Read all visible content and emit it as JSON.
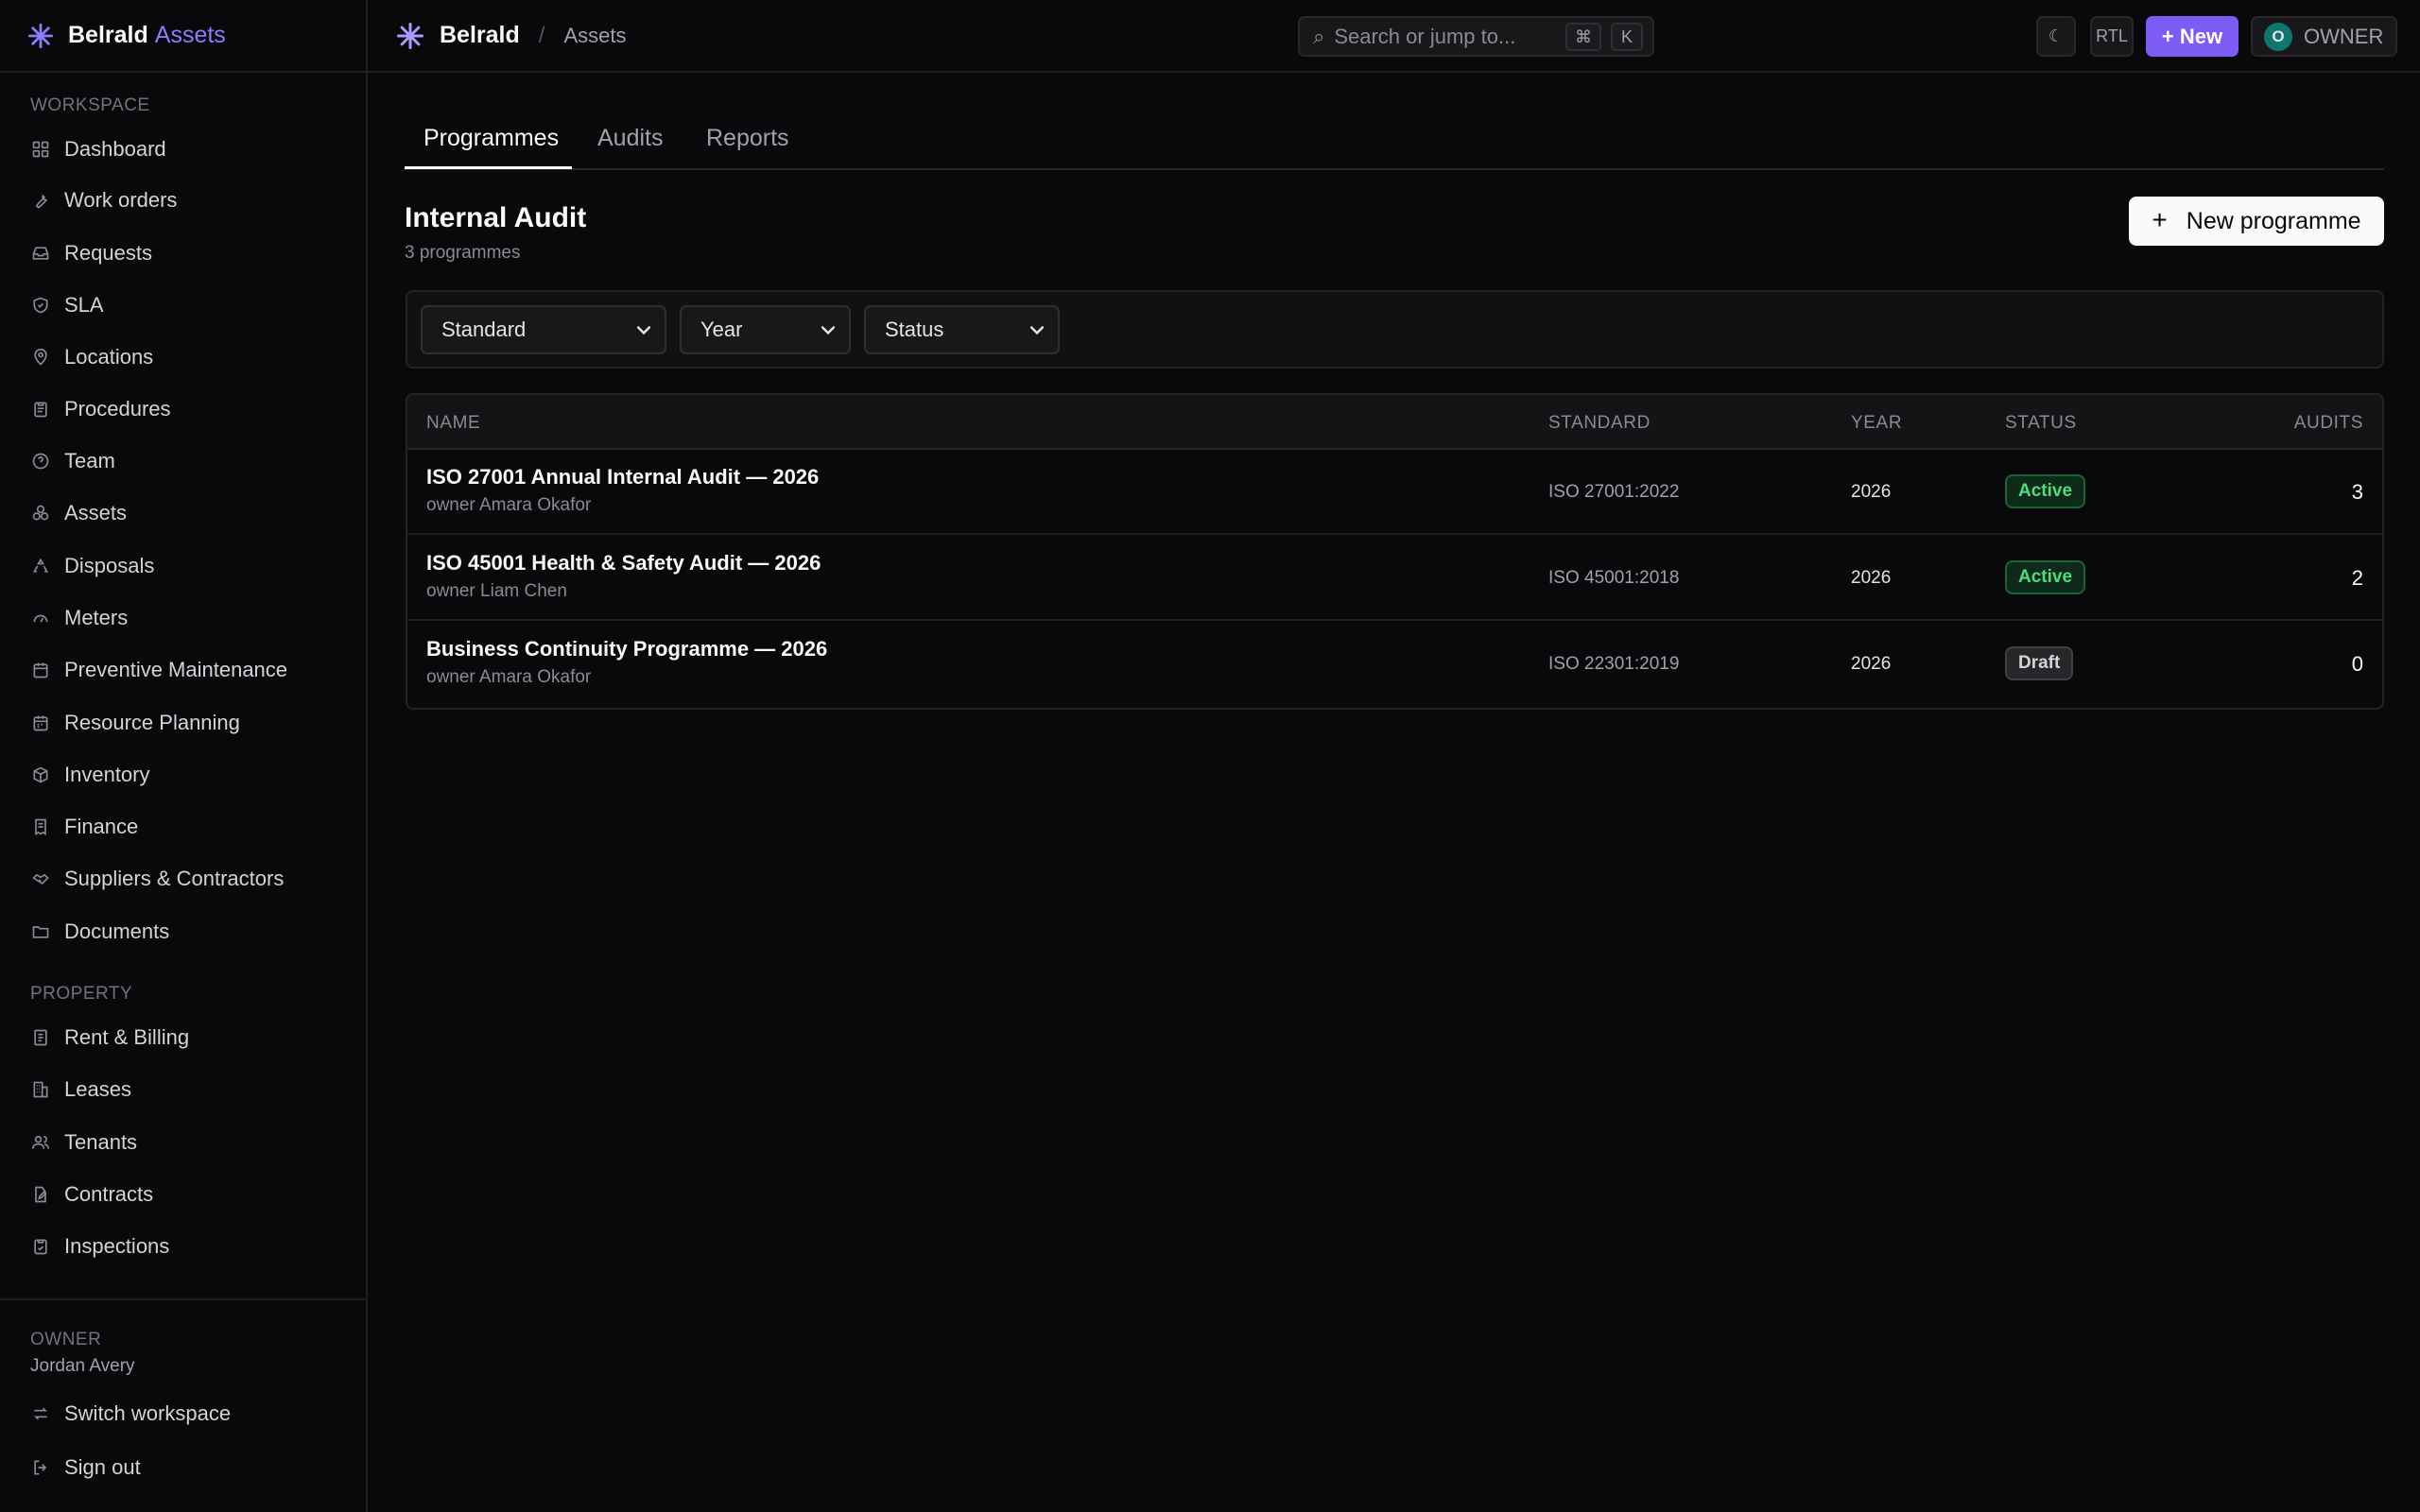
{
  "brand": {
    "name": "Belrald",
    "accent": "Assets"
  },
  "sidebar": {
    "section_workspace": "WORKSPACE",
    "section_property": "PROPERTY",
    "items": [
      {
        "label": "Dashboard",
        "icon": "grid-icon"
      },
      {
        "label": "Work orders",
        "icon": "wrench-icon"
      },
      {
        "label": "Requests",
        "icon": "inbox-icon"
      },
      {
        "label": "SLA",
        "icon": "shield-icon"
      },
      {
        "label": "Locations",
        "icon": "map-pin-icon"
      },
      {
        "label": "Procedures",
        "icon": "clipboard-icon"
      },
      {
        "label": "Team",
        "icon": "users-icon"
      },
      {
        "label": "Assets",
        "icon": "boxes-icon"
      },
      {
        "label": "Disposals",
        "icon": "recycle-icon"
      },
      {
        "label": "Meters",
        "icon": "gauge-icon"
      },
      {
        "label": "Preventive Maintenance",
        "icon": "calendar-icon"
      },
      {
        "label": "Resource Planning",
        "icon": "calendar-grid-icon"
      },
      {
        "label": "Inventory",
        "icon": "package-icon"
      },
      {
        "label": "Finance",
        "icon": "receipt-icon"
      },
      {
        "label": "Suppliers & Contractors",
        "icon": "handshake-icon"
      },
      {
        "label": "Documents",
        "icon": "folder-icon"
      }
    ],
    "property_items": [
      {
        "label": "Rent & Billing",
        "icon": "receipt-icon"
      },
      {
        "label": "Leases",
        "icon": "building-icon"
      },
      {
        "label": "Tenants",
        "icon": "users-icon"
      },
      {
        "label": "Contracts",
        "icon": "file-pen-icon"
      },
      {
        "label": "Inspections",
        "icon": "clipboard-check-icon"
      }
    ],
    "owner_label": "OWNER",
    "owner_name": "Jordan Avery",
    "switch_workspace": "Switch workspace",
    "sign_out": "Sign out"
  },
  "topbar": {
    "crumb_main": "Belrald",
    "crumb_sep": "/",
    "crumb_sub": "Assets",
    "search_placeholder": "Search or jump to...",
    "kbd_cmd": "⌘",
    "kbd_k": "K",
    "rtl": "RTL",
    "new_label": "+ New",
    "avatar_initial": "O",
    "role": "OWNER"
  },
  "tabs": [
    {
      "label": "Programmes",
      "active": true
    },
    {
      "label": "Audits",
      "active": false
    },
    {
      "label": "Reports",
      "active": false
    }
  ],
  "page": {
    "title": "Internal Audit",
    "subtitle": "3 programmes",
    "new_programme": "New programme"
  },
  "filters": {
    "standard": "Standard",
    "year": "Year",
    "status": "Status"
  },
  "table": {
    "headers": {
      "name": "NAME",
      "standard": "STANDARD",
      "year": "YEAR",
      "status": "STATUS",
      "audits": "AUDITS"
    },
    "rows": [
      {
        "name": "ISO 27001 Annual Internal Audit — 2026",
        "owner": "owner Amara Okafor",
        "standard": "ISO 27001:2022",
        "year": "2026",
        "status": "Active",
        "audits": "3"
      },
      {
        "name": "ISO 45001 Health & Safety Audit — 2026",
        "owner": "owner Liam Chen",
        "standard": "ISO 45001:2018",
        "year": "2026",
        "status": "Active",
        "audits": "2"
      },
      {
        "name": "Business Continuity Programme — 2026",
        "owner": "owner Amara Okafor",
        "standard": "ISO 22301:2019",
        "year": "2026",
        "status": "Draft",
        "audits": "0"
      }
    ]
  },
  "colors": {
    "accent": "#7c5cf5",
    "active_badge": "#4ade80",
    "background": "#09090b"
  }
}
